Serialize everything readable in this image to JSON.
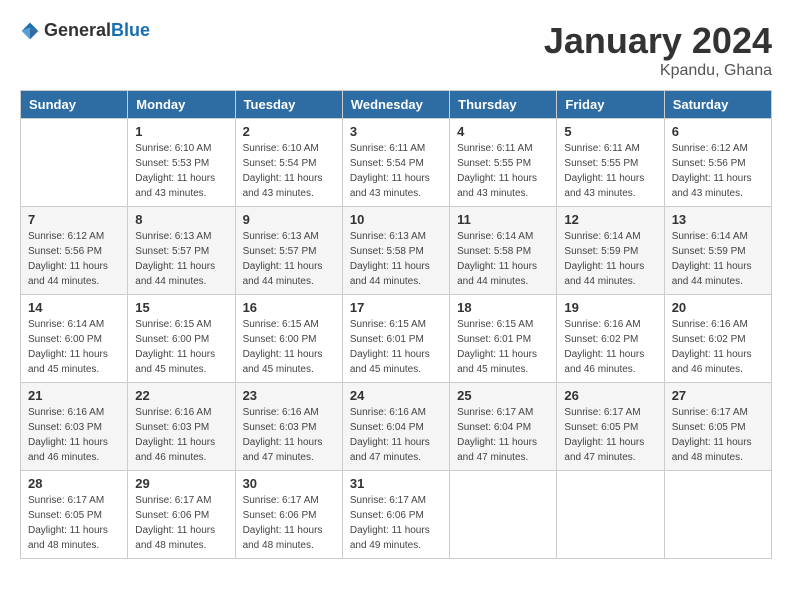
{
  "header": {
    "logo_general": "General",
    "logo_blue": "Blue",
    "main_title": "January 2024",
    "subtitle": "Kpandu, Ghana"
  },
  "calendar": {
    "days_of_week": [
      "Sunday",
      "Monday",
      "Tuesday",
      "Wednesday",
      "Thursday",
      "Friday",
      "Saturday"
    ],
    "weeks": [
      [
        {
          "day": "",
          "info": ""
        },
        {
          "day": "1",
          "info": "Sunrise: 6:10 AM\nSunset: 5:53 PM\nDaylight: 11 hours\nand 43 minutes."
        },
        {
          "day": "2",
          "info": "Sunrise: 6:10 AM\nSunset: 5:54 PM\nDaylight: 11 hours\nand 43 minutes."
        },
        {
          "day": "3",
          "info": "Sunrise: 6:11 AM\nSunset: 5:54 PM\nDaylight: 11 hours\nand 43 minutes."
        },
        {
          "day": "4",
          "info": "Sunrise: 6:11 AM\nSunset: 5:55 PM\nDaylight: 11 hours\nand 43 minutes."
        },
        {
          "day": "5",
          "info": "Sunrise: 6:11 AM\nSunset: 5:55 PM\nDaylight: 11 hours\nand 43 minutes."
        },
        {
          "day": "6",
          "info": "Sunrise: 6:12 AM\nSunset: 5:56 PM\nDaylight: 11 hours\nand 43 minutes."
        }
      ],
      [
        {
          "day": "7",
          "info": "Sunrise: 6:12 AM\nSunset: 5:56 PM\nDaylight: 11 hours\nand 44 minutes."
        },
        {
          "day": "8",
          "info": "Sunrise: 6:13 AM\nSunset: 5:57 PM\nDaylight: 11 hours\nand 44 minutes."
        },
        {
          "day": "9",
          "info": "Sunrise: 6:13 AM\nSunset: 5:57 PM\nDaylight: 11 hours\nand 44 minutes."
        },
        {
          "day": "10",
          "info": "Sunrise: 6:13 AM\nSunset: 5:58 PM\nDaylight: 11 hours\nand 44 minutes."
        },
        {
          "day": "11",
          "info": "Sunrise: 6:14 AM\nSunset: 5:58 PM\nDaylight: 11 hours\nand 44 minutes."
        },
        {
          "day": "12",
          "info": "Sunrise: 6:14 AM\nSunset: 5:59 PM\nDaylight: 11 hours\nand 44 minutes."
        },
        {
          "day": "13",
          "info": "Sunrise: 6:14 AM\nSunset: 5:59 PM\nDaylight: 11 hours\nand 44 minutes."
        }
      ],
      [
        {
          "day": "14",
          "info": "Sunrise: 6:14 AM\nSunset: 6:00 PM\nDaylight: 11 hours\nand 45 minutes."
        },
        {
          "day": "15",
          "info": "Sunrise: 6:15 AM\nSunset: 6:00 PM\nDaylight: 11 hours\nand 45 minutes."
        },
        {
          "day": "16",
          "info": "Sunrise: 6:15 AM\nSunset: 6:00 PM\nDaylight: 11 hours\nand 45 minutes."
        },
        {
          "day": "17",
          "info": "Sunrise: 6:15 AM\nSunset: 6:01 PM\nDaylight: 11 hours\nand 45 minutes."
        },
        {
          "day": "18",
          "info": "Sunrise: 6:15 AM\nSunset: 6:01 PM\nDaylight: 11 hours\nand 45 minutes."
        },
        {
          "day": "19",
          "info": "Sunrise: 6:16 AM\nSunset: 6:02 PM\nDaylight: 11 hours\nand 46 minutes."
        },
        {
          "day": "20",
          "info": "Sunrise: 6:16 AM\nSunset: 6:02 PM\nDaylight: 11 hours\nand 46 minutes."
        }
      ],
      [
        {
          "day": "21",
          "info": "Sunrise: 6:16 AM\nSunset: 6:03 PM\nDaylight: 11 hours\nand 46 minutes."
        },
        {
          "day": "22",
          "info": "Sunrise: 6:16 AM\nSunset: 6:03 PM\nDaylight: 11 hours\nand 46 minutes."
        },
        {
          "day": "23",
          "info": "Sunrise: 6:16 AM\nSunset: 6:03 PM\nDaylight: 11 hours\nand 47 minutes."
        },
        {
          "day": "24",
          "info": "Sunrise: 6:16 AM\nSunset: 6:04 PM\nDaylight: 11 hours\nand 47 minutes."
        },
        {
          "day": "25",
          "info": "Sunrise: 6:17 AM\nSunset: 6:04 PM\nDaylight: 11 hours\nand 47 minutes."
        },
        {
          "day": "26",
          "info": "Sunrise: 6:17 AM\nSunset: 6:05 PM\nDaylight: 11 hours\nand 47 minutes."
        },
        {
          "day": "27",
          "info": "Sunrise: 6:17 AM\nSunset: 6:05 PM\nDaylight: 11 hours\nand 48 minutes."
        }
      ],
      [
        {
          "day": "28",
          "info": "Sunrise: 6:17 AM\nSunset: 6:05 PM\nDaylight: 11 hours\nand 48 minutes."
        },
        {
          "day": "29",
          "info": "Sunrise: 6:17 AM\nSunset: 6:06 PM\nDaylight: 11 hours\nand 48 minutes."
        },
        {
          "day": "30",
          "info": "Sunrise: 6:17 AM\nSunset: 6:06 PM\nDaylight: 11 hours\nand 48 minutes."
        },
        {
          "day": "31",
          "info": "Sunrise: 6:17 AM\nSunset: 6:06 PM\nDaylight: 11 hours\nand 49 minutes."
        },
        {
          "day": "",
          "info": ""
        },
        {
          "day": "",
          "info": ""
        },
        {
          "day": "",
          "info": ""
        }
      ]
    ]
  }
}
